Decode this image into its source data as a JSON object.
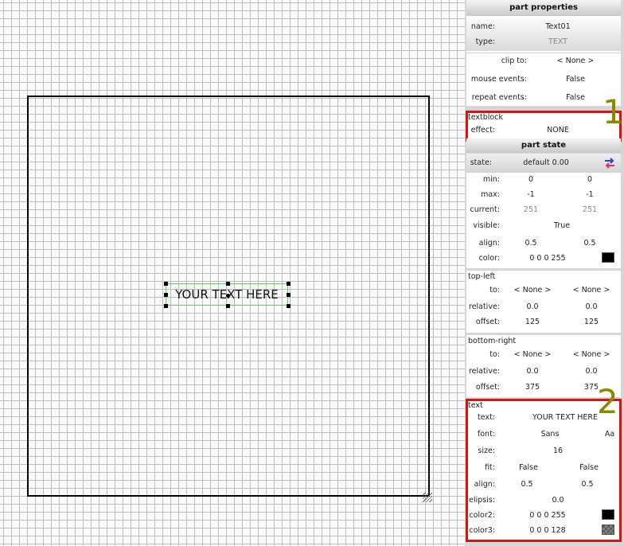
{
  "canvas": {
    "text_part_label": "YOUR TEXT HERE"
  },
  "part_properties": {
    "title": "part properties",
    "name_label": "name:",
    "name_value": "Text01",
    "type_label": "type:",
    "type_value": "TEXT",
    "clip_to_label": "clip to:",
    "clip_to_value": "< None >",
    "mouse_events_label": "mouse events:",
    "mouse_events_value": "False",
    "repeat_events_label": "repeat events:",
    "repeat_events_value": "False"
  },
  "textblock": {
    "title": "textblock",
    "effect_label": "effect:",
    "effect_value": "NONE",
    "callout": "1"
  },
  "part_state": {
    "title": "part state",
    "state_label": "state:",
    "state_value": "default 0.00",
    "min_label": "min:",
    "min_x": "0",
    "min_y": "0",
    "max_label": "max:",
    "max_x": "-1",
    "max_y": "-1",
    "current_label": "current:",
    "current_x": "251",
    "current_y": "251",
    "visible_label": "visible:",
    "visible_value": "True",
    "align_label": "align:",
    "align_x": "0.5",
    "align_y": "0.5",
    "color_label": "color:",
    "color_value": "0 0 0 255",
    "color_swatch": "#000000"
  },
  "top_left": {
    "title": "top-left",
    "to_label": "to:",
    "to_x": "< None >",
    "to_y": "< None >",
    "relative_label": "relative:",
    "relative_x": "0.0",
    "relative_y": "0.0",
    "offset_label": "offset:",
    "offset_x": "125",
    "offset_y": "125"
  },
  "bottom_right": {
    "title": "bottom-right",
    "to_label": "to:",
    "to_x": "< None >",
    "to_y": "< None >",
    "relative_label": "relative:",
    "relative_x": "0.0",
    "relative_y": "0.0",
    "offset_label": "offset:",
    "offset_x": "375",
    "offset_y": "375"
  },
  "text": {
    "title": "text",
    "text_label": "text:",
    "text_value": "YOUR TEXT HERE",
    "font_label": "font:",
    "font_value": "Sans",
    "font_button": "Aa",
    "size_label": "size:",
    "size_value": "16",
    "fit_label": "fit:",
    "fit_x": "False",
    "fit_y": "False",
    "align_label": "align:",
    "align_x": "0.5",
    "align_y": "0.5",
    "elipsis_label": "elipsis:",
    "elipsis_value": "0.0",
    "color2_label": "color2:",
    "color2_value": "0 0 0 255",
    "color2_swatch": "#000000",
    "color3_label": "color3:",
    "color3_value": "0 0 0 128",
    "color3_swatch": "#5a5a5a",
    "callout": "2"
  },
  "colors": {
    "highlight_box": "#e01010",
    "callout_text": "#8a8a00",
    "selection_border": "#5ed05e"
  }
}
